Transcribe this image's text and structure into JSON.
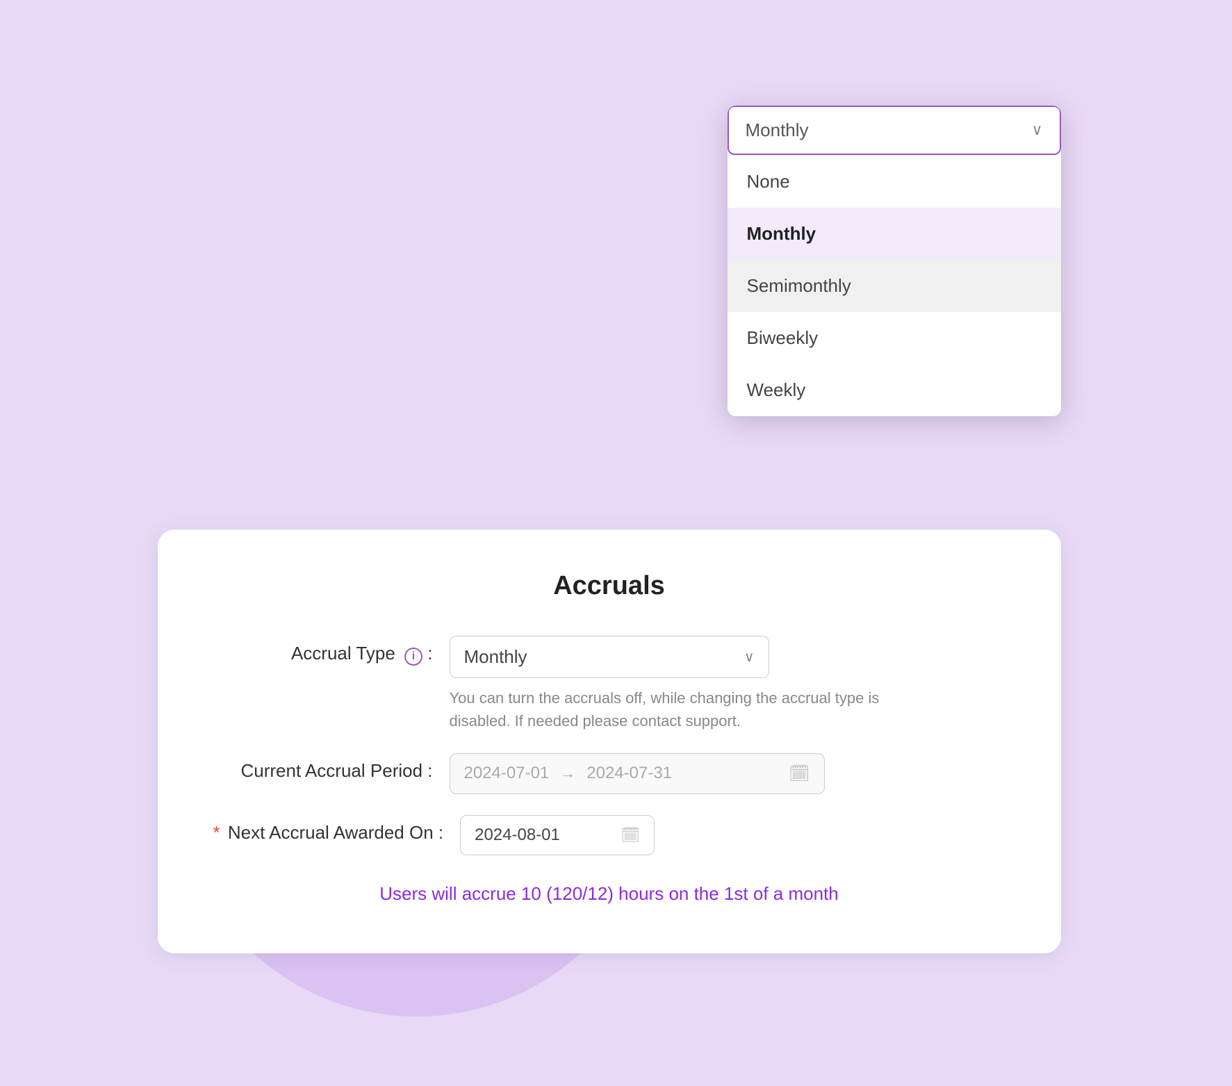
{
  "background": {
    "color": "#e8d9f7"
  },
  "dropdown": {
    "trigger_value": "Monthly",
    "chevron": "⌄",
    "options": [
      {
        "value": "None",
        "label": "None",
        "selected": false,
        "hovered": false
      },
      {
        "value": "Monthly",
        "label": "Monthly",
        "selected": true,
        "hovered": false
      },
      {
        "value": "Semimonthly",
        "label": "Semimonthly",
        "selected": false,
        "hovered": true
      },
      {
        "value": "Biweekly",
        "label": "Biweekly",
        "selected": false,
        "hovered": false
      },
      {
        "value": "Weekly",
        "label": "Weekly",
        "selected": false,
        "hovered": false
      }
    ]
  },
  "card": {
    "title": "Accruals",
    "accrual_type": {
      "label": "Accrual Type",
      "info_icon": "i",
      "value": "Monthly",
      "chevron": "⌄",
      "helper_text": "You can turn the accruals off, while changing the accrual type is disabled. If needed please contact support."
    },
    "current_accrual_period": {
      "label": "Current Accrual Period :",
      "start_date": "2024-07-01",
      "arrow": "→",
      "end_date": "2024-07-31",
      "calendar_icon": "📅"
    },
    "next_accrual": {
      "required": true,
      "label": "Next Accrual Awarded On :",
      "date": "2024-08-01",
      "calendar_icon": "📅"
    },
    "accrual_info_text": "Users will accrue 10 (120/12) hours on the 1st of a month"
  }
}
